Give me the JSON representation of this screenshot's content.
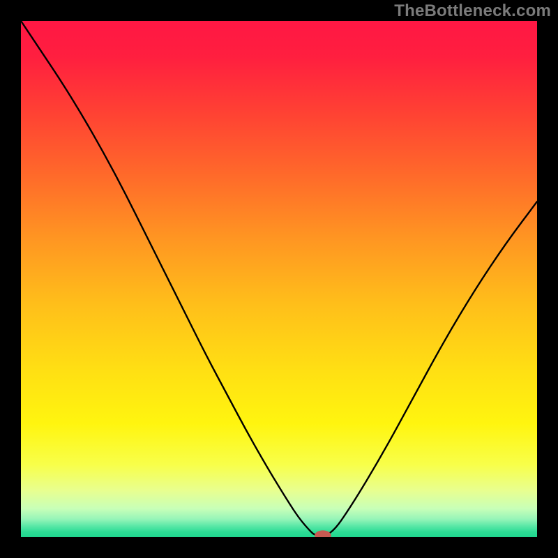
{
  "watermark": "TheBottleneck.com",
  "chart_data": {
    "type": "line",
    "title": "",
    "xlabel": "",
    "ylabel": "",
    "xlim": [
      0,
      100
    ],
    "ylim": [
      0,
      100
    ],
    "grid": false,
    "legend": false,
    "background_gradient_stops": [
      {
        "offset": 0.0,
        "color": "#ff1744"
      },
      {
        "offset": 0.07,
        "color": "#ff1f3f"
      },
      {
        "offset": 0.18,
        "color": "#ff4233"
      },
      {
        "offset": 0.3,
        "color": "#ff6a2a"
      },
      {
        "offset": 0.42,
        "color": "#ff9522"
      },
      {
        "offset": 0.55,
        "color": "#ffbf1a"
      },
      {
        "offset": 0.68,
        "color": "#ffe013"
      },
      {
        "offset": 0.78,
        "color": "#fff50f"
      },
      {
        "offset": 0.86,
        "color": "#f8ff4a"
      },
      {
        "offset": 0.91,
        "color": "#e8ff90"
      },
      {
        "offset": 0.945,
        "color": "#c8ffb8"
      },
      {
        "offset": 0.965,
        "color": "#96f5b8"
      },
      {
        "offset": 0.978,
        "color": "#5ce8a8"
      },
      {
        "offset": 0.99,
        "color": "#2ddc95"
      },
      {
        "offset": 1.0,
        "color": "#1fd68f"
      }
    ],
    "series": [
      {
        "name": "bottleneck-curve",
        "stroke": "#000000",
        "stroke_width": 2.4,
        "x": [
          0,
          4,
          8,
          12,
          16,
          20,
          24,
          28,
          32,
          36,
          40,
          44,
          48,
          52,
          54,
          56,
          57,
          60,
          64,
          70,
          76,
          82,
          88,
          94,
          100
        ],
        "y": [
          100,
          94,
          88,
          81.5,
          74.5,
          67,
          59,
          51,
          43,
          35,
          27.5,
          20,
          13,
          6.5,
          3.5,
          1.2,
          0.3,
          0.3,
          6,
          16,
          27,
          38,
          48,
          57,
          65
        ]
      }
    ],
    "marker": {
      "name": "optimal-point",
      "x": 58.5,
      "y": 0.3,
      "rx": 1.6,
      "ry": 1.0,
      "fill": "#c75a52"
    }
  }
}
